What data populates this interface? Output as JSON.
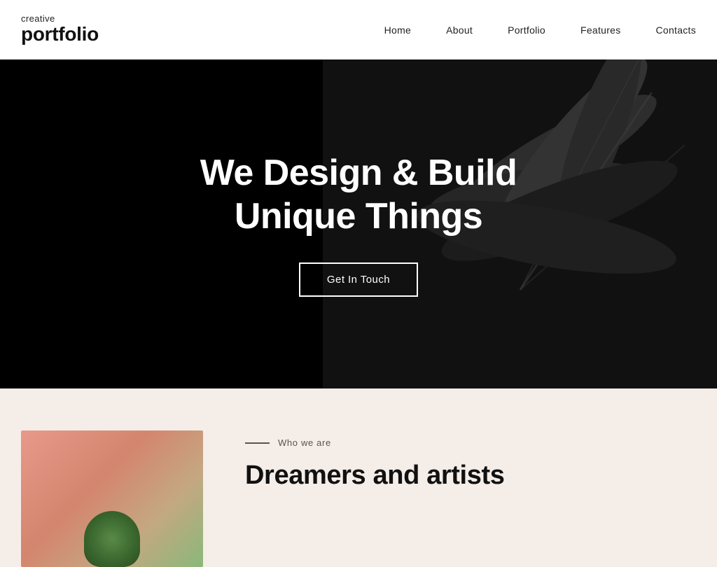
{
  "header": {
    "logo": {
      "small": "creative",
      "large": "portfolio"
    },
    "nav": {
      "items": [
        {
          "label": "Home",
          "id": "home"
        },
        {
          "label": "About",
          "id": "about"
        },
        {
          "label": "Portfolio",
          "id": "portfolio"
        },
        {
          "label": "Features",
          "id": "features"
        },
        {
          "label": "Contacts",
          "id": "contacts"
        }
      ]
    }
  },
  "hero": {
    "title_line1": "We Design & Build",
    "title_line2": "Unique Things",
    "cta_label": "Get In Touch"
  },
  "about": {
    "label": "Who we are",
    "heading_line1": "Dreamers and artists"
  }
}
